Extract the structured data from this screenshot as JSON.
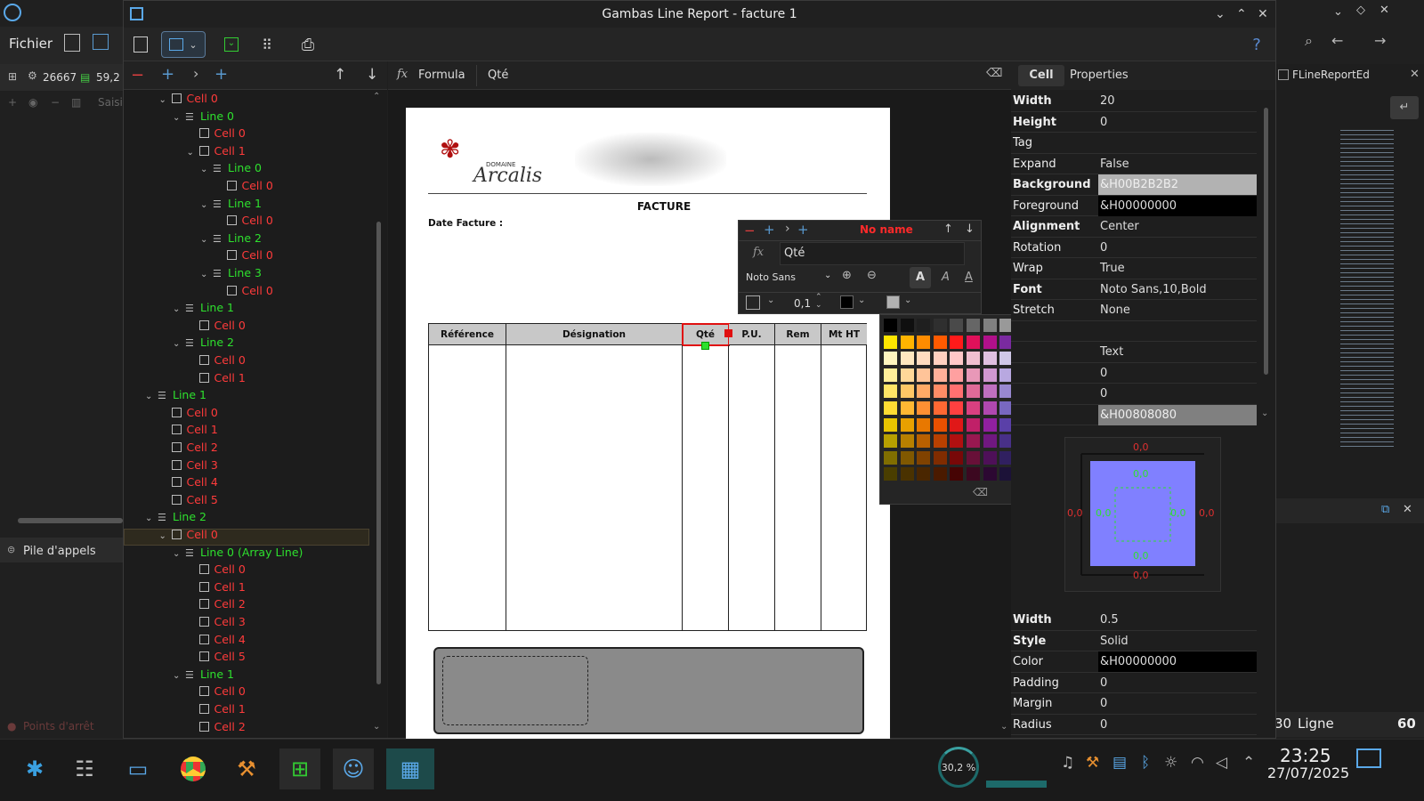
{
  "window": {
    "title": "Gambas Line Report - facture 1"
  },
  "ide": {
    "menu_file": "Fichier",
    "status_count": "26667",
    "status_mem": "59,2",
    "status_saisie": "Saisis",
    "pile_label": "Pile d'appels",
    "breakpoints_label": "Points d'arrêt",
    "right_tab": "FLineReportEd",
    "line_label": "Ligne",
    "line_left": "30",
    "line_value": "60"
  },
  "formula": {
    "icon": "fx",
    "label": "Formula",
    "value": "Qté"
  },
  "tree": {
    "items": [
      {
        "label": "Cell 0",
        "kind": "cell",
        "depth": 1,
        "exp": true
      },
      {
        "label": "Line 0",
        "kind": "line",
        "depth": 2,
        "exp": true
      },
      {
        "label": "Cell 0",
        "kind": "cell",
        "depth": 3,
        "exp": false
      },
      {
        "label": "Cell 1",
        "kind": "cell",
        "depth": 3,
        "exp": true
      },
      {
        "label": "Line 0",
        "kind": "line",
        "depth": 4,
        "exp": true
      },
      {
        "label": "Cell 0",
        "kind": "cell",
        "depth": 5,
        "exp": false
      },
      {
        "label": "Line 1",
        "kind": "line",
        "depth": 4,
        "exp": true
      },
      {
        "label": "Cell 0",
        "kind": "cell",
        "depth": 5,
        "exp": false
      },
      {
        "label": "Line 2",
        "kind": "line",
        "depth": 4,
        "exp": true
      },
      {
        "label": "Cell 0",
        "kind": "cell",
        "depth": 5,
        "exp": false
      },
      {
        "label": "Line 3",
        "kind": "line",
        "depth": 4,
        "exp": true
      },
      {
        "label": "Cell 0",
        "kind": "cell",
        "depth": 5,
        "exp": false
      },
      {
        "label": "Line 1",
        "kind": "line",
        "depth": 2,
        "exp": true
      },
      {
        "label": "Cell 0",
        "kind": "cell",
        "depth": 3,
        "exp": false
      },
      {
        "label": "Line 2",
        "kind": "line",
        "depth": 2,
        "exp": true
      },
      {
        "label": "Cell 0",
        "kind": "cell",
        "depth": 3,
        "exp": false
      },
      {
        "label": "Cell 1",
        "kind": "cell",
        "depth": 3,
        "exp": false
      },
      {
        "label": "Line 1",
        "kind": "line",
        "depth": 0,
        "exp": true
      },
      {
        "label": "Cell 0",
        "kind": "cell",
        "depth": 1,
        "exp": false
      },
      {
        "label": "Cell 1",
        "kind": "cell",
        "depth": 1,
        "exp": false
      },
      {
        "label": "Cell 2",
        "kind": "cell",
        "depth": 1,
        "exp": false
      },
      {
        "label": "Cell 3",
        "kind": "cell",
        "depth": 1,
        "exp": false
      },
      {
        "label": "Cell 4",
        "kind": "cell",
        "depth": 1,
        "exp": false
      },
      {
        "label": "Cell 5",
        "kind": "cell",
        "depth": 1,
        "exp": false
      },
      {
        "label": "Line 2",
        "kind": "line",
        "depth": 0,
        "exp": true
      },
      {
        "label": "Cell 0",
        "kind": "cell",
        "depth": 1,
        "exp": true
      },
      {
        "label": "Line 0 (Array Line)",
        "kind": "line",
        "depth": 2,
        "exp": true
      },
      {
        "label": "Cell 0",
        "kind": "cell",
        "depth": 3,
        "exp": false
      },
      {
        "label": "Cell 1",
        "kind": "cell",
        "depth": 3,
        "exp": false
      },
      {
        "label": "Cell 2",
        "kind": "cell",
        "depth": 3,
        "exp": false
      },
      {
        "label": "Cell 3",
        "kind": "cell",
        "depth": 3,
        "exp": false
      },
      {
        "label": "Cell 4",
        "kind": "cell",
        "depth": 3,
        "exp": false
      },
      {
        "label": "Cell 5",
        "kind": "cell",
        "depth": 3,
        "exp": false
      },
      {
        "label": "Line 1",
        "kind": "line",
        "depth": 2,
        "exp": true
      },
      {
        "label": "Cell 0",
        "kind": "cell",
        "depth": 3,
        "exp": false
      },
      {
        "label": "Cell 1",
        "kind": "cell",
        "depth": 3,
        "exp": false
      },
      {
        "label": "Cell 2",
        "kind": "cell",
        "depth": 3,
        "exp": false
      }
    ]
  },
  "report": {
    "logo_small": "DOMAINE",
    "logo_big": "Arcalis",
    "title": "FACTURE",
    "date_label": "Date Facture :",
    "columns": [
      "Référence",
      "Désignation",
      "Qté",
      "P.U.",
      "Rem",
      "Mt HT"
    ]
  },
  "popup": {
    "name": "No name",
    "fx": "fx",
    "value": "Qté",
    "font": "Noto Sans",
    "border_width": "0,1",
    "style_a": "A"
  },
  "palette": {
    "rows": [
      [
        "#000000",
        "#0f0f0f",
        "#1f1f1f",
        "#2f2f2f",
        "#4a4a4a",
        "#666666",
        "#808080",
        "#999999",
        "#b3b3b3",
        "#cccccc",
        "#e6e6e6",
        "#ffffff"
      ],
      [
        "#ffe600",
        "#ffb400",
        "#ff8c00",
        "#ff5a00",
        "#ff1a1a",
        "#e0105a",
        "#b0108a",
        "#7a2aa0",
        "#3a5cb0",
        "#1a8aa0",
        "#10a050",
        "#70c020"
      ],
      [
        "#fff6c0",
        "#ffe8c0",
        "#ffdcc0",
        "#ffd0c0",
        "#ffc8c8",
        "#f0c0d0",
        "#e0c0e0",
        "#d0c8e8",
        "#c8d0f0",
        "#c0e0e8",
        "#c8ecd0",
        "#e0f0c0"
      ],
      [
        "#ffee99",
        "#ffd899",
        "#ffc499",
        "#ffb099",
        "#ffa0a0",
        "#e898b8",
        "#d098d0",
        "#b8a8e0",
        "#a8b8e8",
        "#98d0e0",
        "#a0e0b0",
        "#d0e898"
      ],
      [
        "#ffe566",
        "#ffc866",
        "#ffaa66",
        "#ff8c66",
        "#ff7070",
        "#e06a98",
        "#c070c0",
        "#9888d0",
        "#8098d8",
        "#70c0d0",
        "#70d090",
        "#b8dc70"
      ],
      [
        "#ffdc33",
        "#ffb833",
        "#ff9033",
        "#ff6833",
        "#ff4040",
        "#d84080",
        "#b048b0",
        "#7868c0",
        "#5878c8",
        "#48a8c0",
        "#48c070",
        "#a0d048"
      ],
      [
        "#e8c400",
        "#e8a000",
        "#e87800",
        "#e85000",
        "#e01818",
        "#c02068",
        "#9020a0",
        "#5a40a8",
        "#3858b0",
        "#2090a8",
        "#20a858",
        "#80b820"
      ],
      [
        "#b8a000",
        "#b88000",
        "#b86000",
        "#b84000",
        "#b01010",
        "#981850",
        "#701880",
        "#483088",
        "#284890",
        "#187488",
        "#188848",
        "#609018"
      ],
      [
        "#806e00",
        "#805800",
        "#804200",
        "#802c00",
        "#780808",
        "#681038",
        "#4e1058",
        "#302060",
        "#1c3064",
        "#104e5c",
        "#105c30",
        "#406010"
      ],
      [
        "#4a3e00",
        "#4a3200",
        "#4a2600",
        "#4a1a00",
        "#460404",
        "#3c0820",
        "#2c0832",
        "#1c1238",
        "#101c3a",
        "#0a2e36",
        "#0a361c",
        "#26380a"
      ]
    ]
  },
  "props": {
    "tab_cell": "Cell",
    "tab_properties": "Properties",
    "rows": [
      {
        "k": "Width",
        "v": "20",
        "bold": true,
        "vbg": ""
      },
      {
        "k": "Height",
        "v": "0",
        "bold": true,
        "vbg": ""
      },
      {
        "k": "Tag",
        "v": "",
        "bold": false,
        "vbg": ""
      },
      {
        "k": "Expand",
        "v": "False",
        "bold": false,
        "vbg": ""
      },
      {
        "k": "Background",
        "v": "&H00B2B2B2",
        "bold": true,
        "vbg": "#b2b2b2"
      },
      {
        "k": "Foreground",
        "v": "&H00000000",
        "bold": false,
        "vbg": "#000000"
      },
      {
        "k": "Alignment",
        "v": "Center",
        "bold": true,
        "vbg": ""
      },
      {
        "k": "Rotation",
        "v": "0",
        "bold": false,
        "vbg": ""
      },
      {
        "k": "Wrap",
        "v": "True",
        "bold": false,
        "vbg": ""
      },
      {
        "k": "Font",
        "v": "Noto Sans,10,Bold",
        "bold": true,
        "vbg": ""
      },
      {
        "k": "Stretch",
        "v": "None",
        "bold": false,
        "vbg": ""
      },
      {
        "k": "",
        "v": "",
        "bold": false,
        "vbg": ""
      },
      {
        "k": "",
        "v": "Text",
        "bold": false,
        "vbg": ""
      },
      {
        "k": "",
        "v": "0",
        "bold": false,
        "vbg": ""
      },
      {
        "k": "",
        "v": "0",
        "bold": false,
        "vbg": ""
      },
      {
        "k": "",
        "v": "&H00808080",
        "bold": false,
        "vbg": "#808080"
      }
    ],
    "preview_value": "0,0",
    "border_rows": [
      {
        "k": "Width",
        "v": "0.5",
        "bold": true,
        "vbg": ""
      },
      {
        "k": "Style",
        "v": "Solid",
        "bold": true,
        "vbg": ""
      },
      {
        "k": "Color",
        "v": "&H00000000",
        "bold": false,
        "vbg": "#000000"
      },
      {
        "k": "Padding",
        "v": "0",
        "bold": false,
        "vbg": ""
      },
      {
        "k": "Margin",
        "v": "0",
        "bold": false,
        "vbg": ""
      },
      {
        "k": "Radius",
        "v": "0",
        "bold": false,
        "vbg": ""
      }
    ]
  },
  "taskbar": {
    "cpu": "30,2 %",
    "time": "23:25",
    "date": "27/07/2025"
  }
}
